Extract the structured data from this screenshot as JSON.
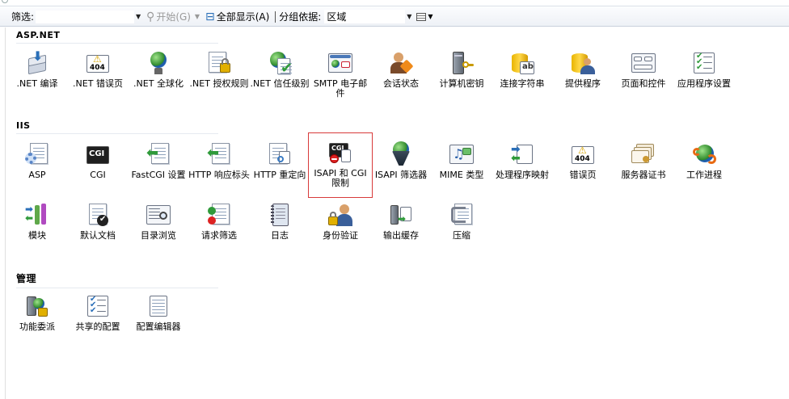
{
  "toolbar": {
    "filter_label": "筛选:",
    "filter_value": "",
    "start_label": "开始(G)",
    "show_all_label": "全部显示(A)",
    "group_by_label": "分组依据:",
    "group_by_value": "区域"
  },
  "groups": {
    "aspnet": {
      "title": "ASP.NET",
      "items": [
        {
          "label": ".NET 编译",
          "icon": "net-compile-icon"
        },
        {
          "label": ".NET 错误页",
          "icon": "net-error-pages-icon"
        },
        {
          "label": ".NET 全球化",
          "icon": "net-globalization-icon"
        },
        {
          "label": ".NET 授权规则",
          "icon": "net-authorization-rules-icon"
        },
        {
          "label": ".NET 信任级别",
          "icon": "net-trust-levels-icon"
        },
        {
          "label": "SMTP 电子邮件",
          "icon": "smtp-email-icon"
        },
        {
          "label": "会话状态",
          "icon": "session-state-icon"
        },
        {
          "label": "计算机密钥",
          "icon": "machine-key-icon"
        },
        {
          "label": "连接字符串",
          "icon": "connection-strings-icon"
        },
        {
          "label": "提供程序",
          "icon": "providers-icon"
        },
        {
          "label": "页面和控件",
          "icon": "pages-controls-icon"
        },
        {
          "label": "应用程序设置",
          "icon": "app-settings-icon"
        }
      ]
    },
    "iis": {
      "title": "IIS",
      "items": [
        {
          "label": "ASP",
          "icon": "asp-icon"
        },
        {
          "label": "CGI",
          "icon": "cgi-icon"
        },
        {
          "label": "FastCGI 设置",
          "icon": "fastcgi-icon"
        },
        {
          "label": "HTTP 响应标头",
          "icon": "http-response-headers-icon"
        },
        {
          "label": "HTTP 重定向",
          "icon": "http-redirect-icon"
        },
        {
          "label": "ISAPI 和 CGI 限制",
          "icon": "isapi-cgi-restrictions-icon"
        },
        {
          "label": "ISAPI 筛选器",
          "icon": "isapi-filters-icon"
        },
        {
          "label": "MIME 类型",
          "icon": "mime-types-icon"
        },
        {
          "label": "处理程序映射",
          "icon": "handler-mappings-icon"
        },
        {
          "label": "错误页",
          "icon": "error-pages-icon"
        },
        {
          "label": "服务器证书",
          "icon": "server-certificates-icon"
        },
        {
          "label": "工作进程",
          "icon": "worker-processes-icon"
        },
        {
          "label": "模块",
          "icon": "modules-icon"
        },
        {
          "label": "默认文档",
          "icon": "default-document-icon"
        },
        {
          "label": "目录浏览",
          "icon": "directory-browsing-icon"
        },
        {
          "label": "请求筛选",
          "icon": "request-filtering-icon"
        },
        {
          "label": "日志",
          "icon": "logging-icon"
        },
        {
          "label": "身份验证",
          "icon": "authentication-icon"
        },
        {
          "label": "输出缓存",
          "icon": "output-caching-icon"
        },
        {
          "label": "压缩",
          "icon": "compression-icon"
        }
      ]
    },
    "management": {
      "title": "管理",
      "items": [
        {
          "label": "功能委派",
          "icon": "feature-delegation-icon"
        },
        {
          "label": "共享的配置",
          "icon": "shared-configuration-icon"
        },
        {
          "label": "配置编辑器",
          "icon": "configuration-editor-icon"
        }
      ]
    }
  },
  "selected_item": "ISAPI 和 CGI 限制"
}
